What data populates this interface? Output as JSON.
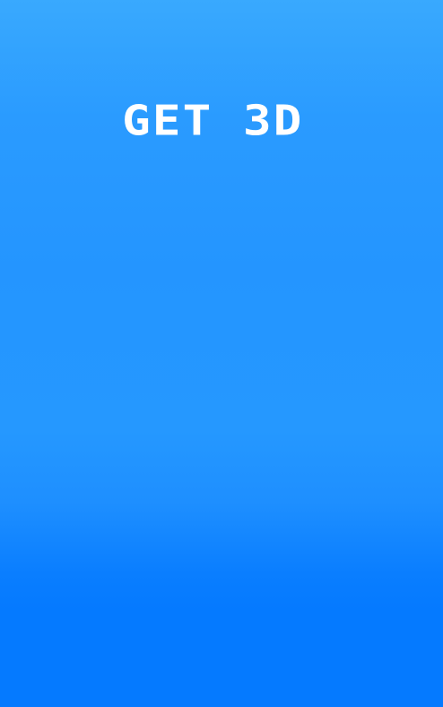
{
  "app": {
    "title": "GET 3D"
  },
  "colors": {
    "background_top": "#39a9fe",
    "background_middle": "#2495ff",
    "background_bottom": "#057aff",
    "title_text": "#ffffff"
  }
}
